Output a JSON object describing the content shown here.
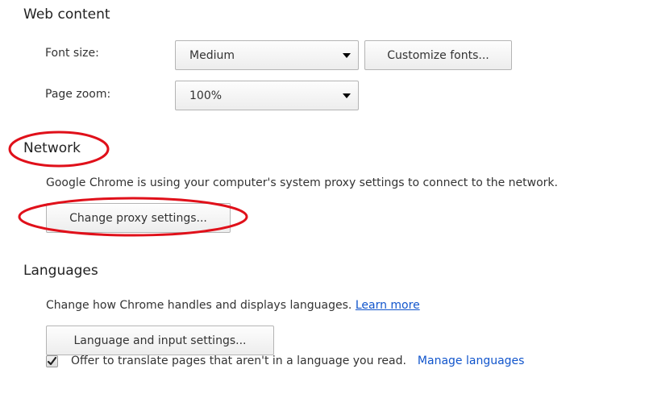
{
  "web_content": {
    "title": "Web content",
    "font_size_label": "Font size:",
    "font_size_value": "Medium",
    "customize_fonts_label": "Customize fonts...",
    "page_zoom_label": "Page zoom:",
    "page_zoom_value": "100%"
  },
  "network": {
    "title": "Network",
    "description": "Google Chrome is using your computer's system proxy settings to connect to the network.",
    "change_proxy_label": "Change proxy settings..."
  },
  "languages": {
    "title": "Languages",
    "description": "Change how Chrome handles and displays languages.",
    "learn_more_label": "Learn more",
    "language_settings_label": "Language and input settings...",
    "translate_checkbox_label": "Offer to translate pages that aren't in a language you read.",
    "translate_checked": true,
    "manage_languages_label": "Manage languages"
  },
  "colors": {
    "link": "#1155cc",
    "annotation_red": "#e0101a"
  }
}
